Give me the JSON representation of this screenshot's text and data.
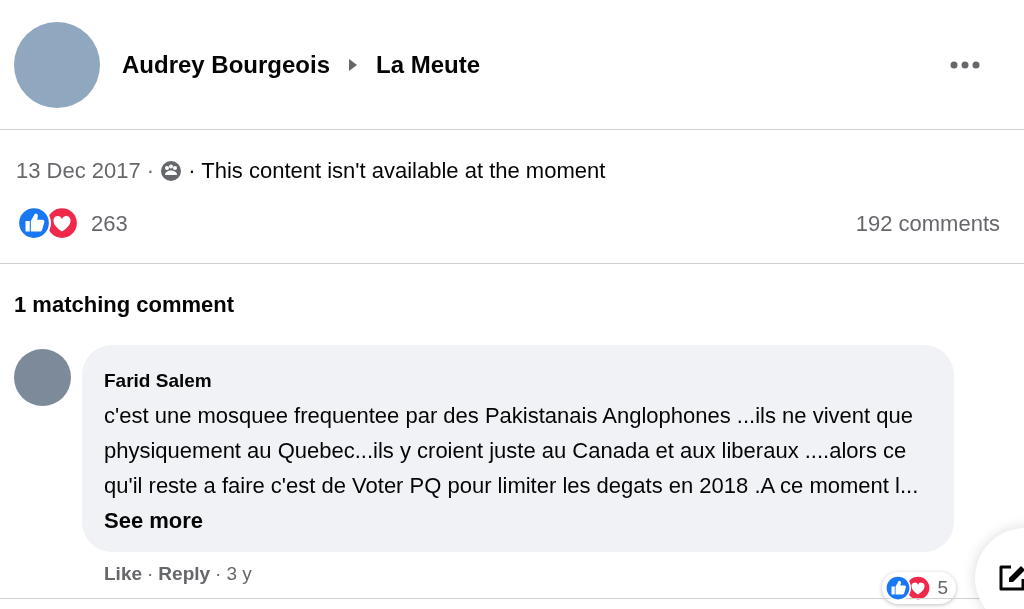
{
  "post": {
    "author": "Audrey Bourgeois",
    "group": "La Meute",
    "date": "13 Dec 2017 ·",
    "notice": "· This content isn't available at the moment",
    "reaction_count": "263",
    "comment_count": "192 comments"
  },
  "comments_section": {
    "heading": "1 matching comment",
    "comment": {
      "author": "Farid Salem",
      "text": "c'est une mosquee frequentee par des Pakistanais Anglophones ...ils ne vivent que physiquement au Quebec...ils y croient juste au Canada et aux liberaux ....alors ce qu'il reste a faire c'est de Voter PQ pour limiter les degats en 2018 .A ce moment l...",
      "see_more": "See more",
      "actions": [
        "Like",
        "Reply"
      ],
      "separator": "·",
      "time": "3 y",
      "reaction_count": "5"
    }
  }
}
